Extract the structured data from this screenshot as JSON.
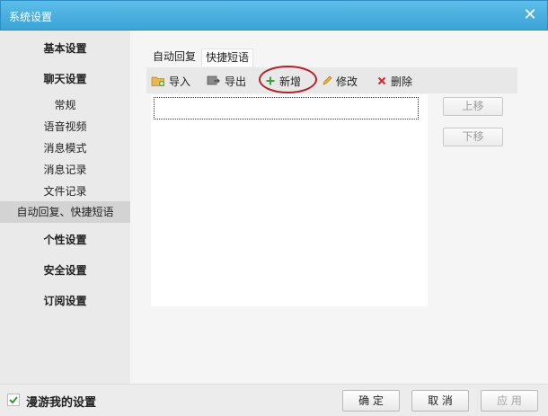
{
  "window": {
    "title": "系统设置",
    "close_glyph": "✕"
  },
  "sidebar": {
    "groups": [
      {
        "label": "基本设置"
      },
      {
        "label": "聊天设置"
      },
      {
        "label": "个性设置"
      },
      {
        "label": "安全设置"
      },
      {
        "label": "订阅设置"
      }
    ],
    "chat_items": [
      {
        "label": "常规"
      },
      {
        "label": "语音视频"
      },
      {
        "label": "消息模式"
      },
      {
        "label": "消息记录"
      },
      {
        "label": "文件记录"
      },
      {
        "label": "自动回复、快捷短语",
        "active": true
      }
    ]
  },
  "tabs": [
    {
      "label": "自动回复"
    },
    {
      "label": "快捷短语",
      "active": true
    }
  ],
  "toolbar": {
    "import_label": "导入",
    "export_label": "导出",
    "add_label": "新增",
    "edit_label": "修改",
    "delete_label": "删除"
  },
  "side_buttons": {
    "up_label": "上移",
    "down_label": "下移"
  },
  "footer": {
    "roam_label": "漫游我的设置",
    "roam_checked": true,
    "ok_label": "确 定",
    "cancel_label": "取 消",
    "apply_label": "应 用"
  },
  "colors": {
    "titlebar": "#3aa3d6",
    "annotation": "#b5212a",
    "check": "#2e9a2e",
    "add": "#3aa03a",
    "delete": "#d42a2a"
  },
  "icons": [
    "close-icon",
    "folder-import-icon",
    "export-icon",
    "plus-icon",
    "pencil-icon",
    "delete-x-icon",
    "checkmark-icon"
  ]
}
